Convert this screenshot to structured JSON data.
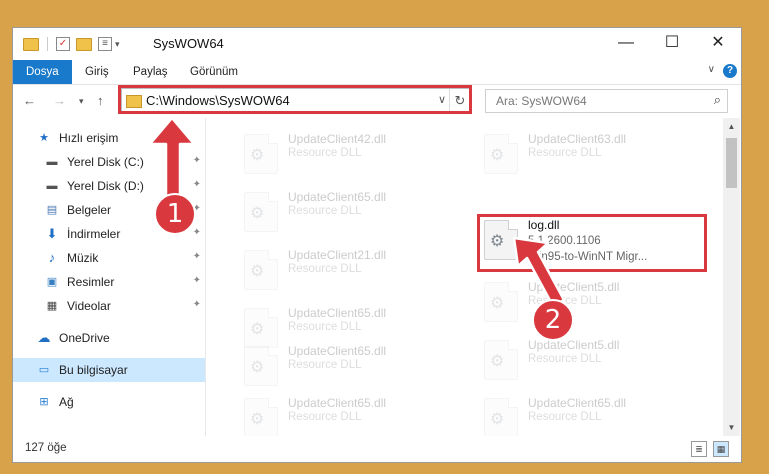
{
  "window": {
    "title": "SysWOW64",
    "quick_access_dropdown": "▾",
    "minimize": "—",
    "maximize": "☐",
    "close": "✕"
  },
  "ribbon": {
    "tabs": [
      "Dosya",
      "Giriş",
      "Paylaş",
      "Görünüm"
    ],
    "expand": "∨",
    "help": "?"
  },
  "navigation": {
    "back": "←",
    "forward": "→",
    "recent": "▾",
    "up": "↑",
    "address": "C:\\Windows\\SysWOW64",
    "address_dropdown": "∨",
    "refresh": "↻",
    "search_placeholder": "Ara: SysWOW64",
    "search_icon": "⌕"
  },
  "nav_pane": {
    "items": [
      {
        "label": "Hızlı erişim",
        "icon": "star-icon",
        "pinned": false
      },
      {
        "label": "Yerel Disk (C:)",
        "icon": "drive-icon",
        "pinned": true
      },
      {
        "label": "Yerel Disk (D:)",
        "icon": "drive-icon",
        "pinned": true
      },
      {
        "label": "Belgeler",
        "icon": "documents-icon",
        "pinned": true
      },
      {
        "label": "İndirmeler",
        "icon": "download-icon",
        "pinned": true
      },
      {
        "label": "Müzik",
        "icon": "music-icon",
        "pinned": true
      },
      {
        "label": "Resimler",
        "icon": "pictures-icon",
        "pinned": true
      },
      {
        "label": "Videolar",
        "icon": "videos-icon",
        "pinned": true
      },
      {
        "label": "OneDrive",
        "icon": "cloud-icon",
        "pinned": false
      },
      {
        "label": "Bu bilgisayar",
        "icon": "computer-icon",
        "pinned": false,
        "selected": true
      },
      {
        "label": "Ağ",
        "icon": "network-icon",
        "pinned": false
      }
    ],
    "pin_glyph": "📌"
  },
  "files": [
    {
      "name": "UpdateClient42.dll",
      "type": "Resource DLL"
    },
    {
      "name": "UpdateClient63.dll",
      "type": "Resource DLL"
    },
    {
      "name": "UpdateClient65.dll",
      "type": "Resource DLL"
    },
    {
      "name": "log.dll",
      "version": "5.1.2600.1106",
      "description": "Win95-to-WinNT Migr...",
      "highlighted": true
    },
    {
      "name": "UpdateClient21.dll",
      "type": "Resource DLL"
    },
    {
      "name": "UpdateClient5.dll",
      "type": "Resource DLL"
    },
    {
      "name": "UpdateClient65.dll",
      "type": "Resource DLL"
    },
    {
      "name": "UpdateClient5.dll",
      "type": "Resource DLL"
    },
    {
      "name": "UpdateClient65.dll",
      "type": "Resource DLL"
    },
    {
      "name": "UpdateClient65.dll",
      "type": "Resource DLL"
    },
    {
      "name": "UpdateClient65.dll",
      "type": "Resource DLL"
    },
    {
      "name": "UpdateClient65.dll",
      "type": "Resource DLL"
    }
  ],
  "status": {
    "item_count": "127 öğe"
  },
  "annotations": {
    "step1": "1",
    "step2": "2",
    "color": "#d9383e"
  }
}
